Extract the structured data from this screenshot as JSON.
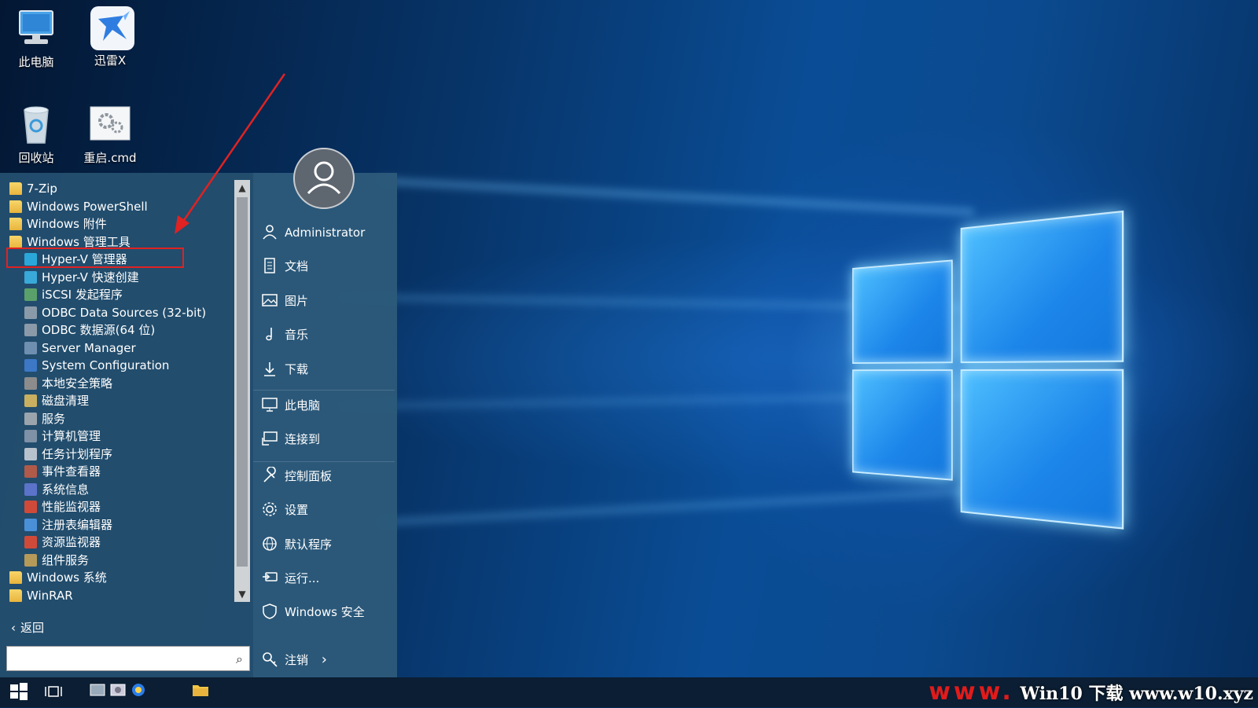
{
  "desktop": {
    "icons": [
      {
        "label": "此电脑",
        "icon": "computer-icon"
      },
      {
        "label": "迅雷X",
        "icon": "thunder-bird-icon"
      },
      {
        "label": "回收站",
        "icon": "recycle-bin-icon"
      },
      {
        "label": "重启.cmd",
        "icon": "cmd-gear-icon"
      }
    ]
  },
  "start_menu": {
    "list": [
      {
        "label": "7-Zip",
        "kind": "folder"
      },
      {
        "label": "Windows PowerShell",
        "kind": "folder"
      },
      {
        "label": "Windows 附件",
        "kind": "folder"
      },
      {
        "label": "Windows 管理工具",
        "kind": "folder"
      },
      {
        "label": "Hyper-V 管理器",
        "kind": "app",
        "color": "#2aa7d8"
      },
      {
        "label": "Hyper-V 快速创建",
        "kind": "app",
        "color": "#39a9d9"
      },
      {
        "label": "iSCSI 发起程序",
        "kind": "app",
        "color": "#5aa06a"
      },
      {
        "label": "ODBC Data Sources (32-bit)",
        "kind": "app",
        "color": "#8a9aa8"
      },
      {
        "label": "ODBC 数据源(64 位)",
        "kind": "app",
        "color": "#8a9aa8"
      },
      {
        "label": "Server Manager",
        "kind": "app",
        "color": "#6f8fb0"
      },
      {
        "label": "System Configuration",
        "kind": "app",
        "color": "#3c78c6"
      },
      {
        "label": "本地安全策略",
        "kind": "app",
        "color": "#8c8c8c"
      },
      {
        "label": "磁盘清理",
        "kind": "app",
        "color": "#c8b060"
      },
      {
        "label": "服务",
        "kind": "app",
        "color": "#9aa4ad"
      },
      {
        "label": "计算机管理",
        "kind": "app",
        "color": "#7f91a6"
      },
      {
        "label": "任务计划程序",
        "kind": "app",
        "color": "#b8c2cc"
      },
      {
        "label": "事件查看器",
        "kind": "app",
        "color": "#b05a4a"
      },
      {
        "label": "系统信息",
        "kind": "app",
        "color": "#5b73c9"
      },
      {
        "label": "性能监视器",
        "kind": "app",
        "color": "#d04a3a"
      },
      {
        "label": "注册表编辑器",
        "kind": "app",
        "color": "#4a90d9"
      },
      {
        "label": "资源监视器",
        "kind": "app",
        "color": "#d04a3a"
      },
      {
        "label": "组件服务",
        "kind": "app",
        "color": "#b59a5a"
      },
      {
        "label": "Windows 系统",
        "kind": "folder"
      },
      {
        "label": "WinRAR",
        "kind": "folder"
      }
    ],
    "back_label": "返回",
    "search": {
      "value": "",
      "placeholder": ""
    },
    "right": {
      "user": "Administrator",
      "items": [
        {
          "label": "文档",
          "icon": "document-icon"
        },
        {
          "label": "图片",
          "icon": "picture-icon"
        },
        {
          "label": "音乐",
          "icon": "music-note-icon"
        },
        {
          "label": "下载",
          "icon": "download-icon"
        },
        {
          "label": "此电脑",
          "icon": "monitor-icon"
        },
        {
          "label": "连接到",
          "icon": "connect-icon"
        },
        {
          "label": "控制面板",
          "icon": "wrench-icon"
        },
        {
          "label": "设置",
          "icon": "gear-icon"
        },
        {
          "label": "默认程序",
          "icon": "globe-icon"
        },
        {
          "label": "运行...",
          "icon": "run-icon"
        },
        {
          "label": "Windows 安全",
          "icon": "shield-icon"
        }
      ],
      "power_label": "注销",
      "power_chevron": "›"
    }
  },
  "taskbar": {
    "watermark_red": "www.",
    "watermark_mid": "Win10 下载",
    "watermark_url": "www.w10.xyz"
  },
  "colors": {
    "highlight_box": "#e02222",
    "arrow": "#e02222",
    "menu_left": "#234e6e",
    "menu_right": "#2c5a7a"
  }
}
